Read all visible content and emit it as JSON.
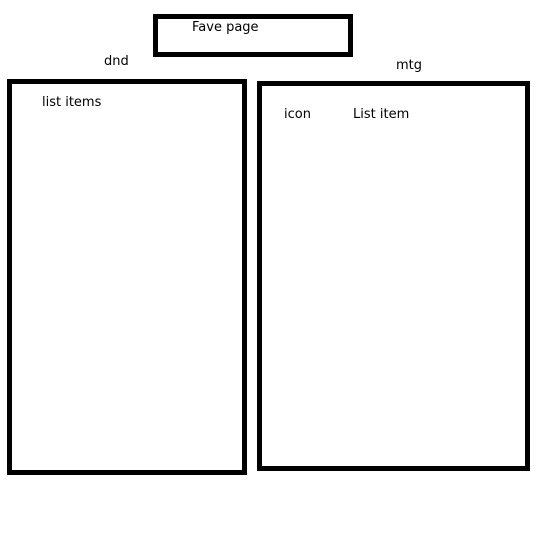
{
  "header": {
    "title": "Fave page"
  },
  "panels": {
    "dnd": {
      "label": "dnd",
      "content": "list items"
    },
    "mtg": {
      "label": "mtg",
      "icon_text": "icon",
      "item_text": "List item"
    }
  },
  "colors": {
    "stroke": "#000000",
    "background": "#ffffff"
  }
}
